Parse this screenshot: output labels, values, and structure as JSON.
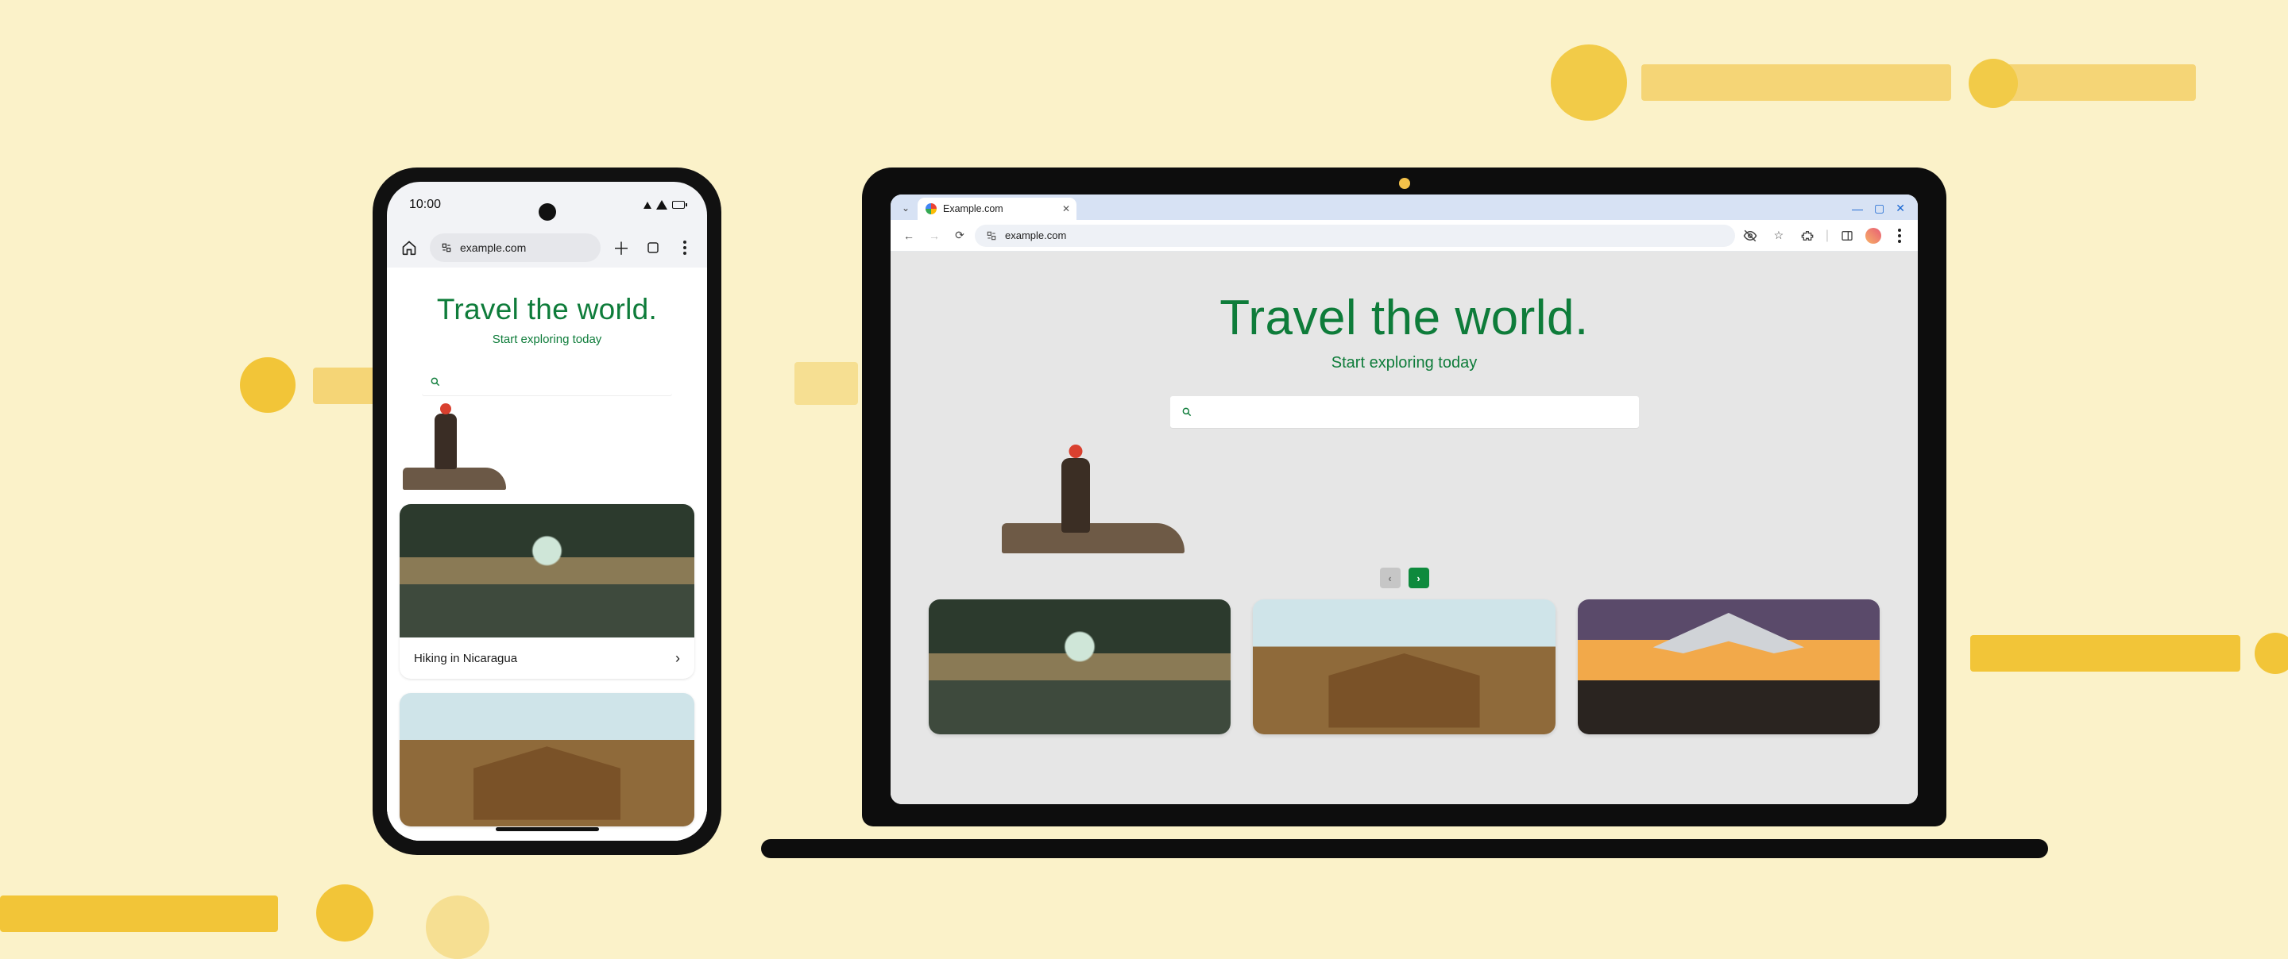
{
  "phone": {
    "status": {
      "time": "10:00"
    },
    "urlbar": {
      "url": "example.com"
    },
    "hero": {
      "title": "Travel the world.",
      "subtitle": "Start exploring today"
    },
    "cards": [
      {
        "label": "Hiking in Nicaragua"
      }
    ]
  },
  "laptop": {
    "tab": {
      "label": "Example.com"
    },
    "urlbar": {
      "url": "example.com"
    },
    "hero": {
      "title": "Travel the world.",
      "subtitle": "Start exploring today"
    }
  },
  "colors": {
    "accent_green": "#0e7c3a",
    "bg_cream": "#fbf2c9",
    "yellow_dark": "#f5c94c",
    "yellow_light": "#f8e28d"
  }
}
